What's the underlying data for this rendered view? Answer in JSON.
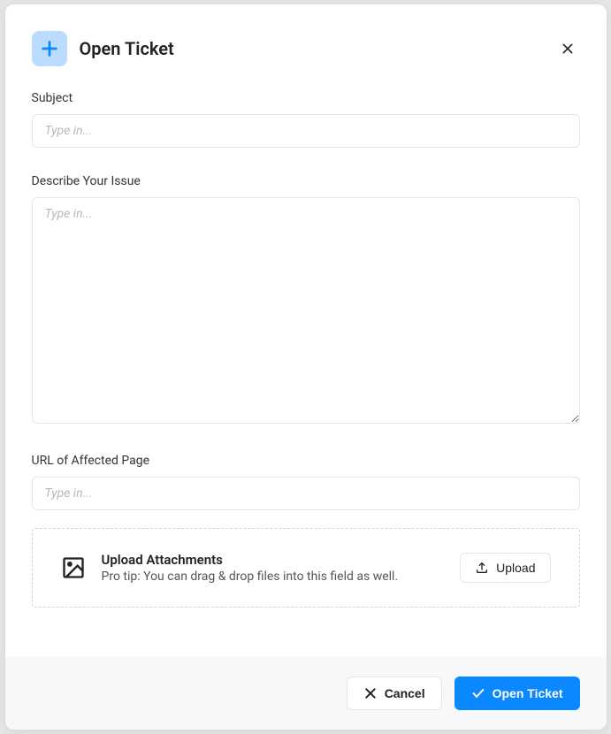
{
  "header": {
    "title": "Open Ticket"
  },
  "fields": {
    "subject": {
      "label": "Subject",
      "placeholder": "Type in...",
      "value": ""
    },
    "issue": {
      "label": "Describe Your Issue",
      "placeholder": "Type in...",
      "value": ""
    },
    "url": {
      "label": "URL of Affected Page",
      "placeholder": "Type in...",
      "value": ""
    }
  },
  "upload": {
    "title": "Upload Attachments",
    "subtitle": "Pro tip: You can drag & drop files into this field as well.",
    "button": "Upload"
  },
  "footer": {
    "cancel": "Cancel",
    "submit": "Open Ticket"
  },
  "colors": {
    "primary": "#0b87ff",
    "iconBg": "#bcdcff"
  }
}
